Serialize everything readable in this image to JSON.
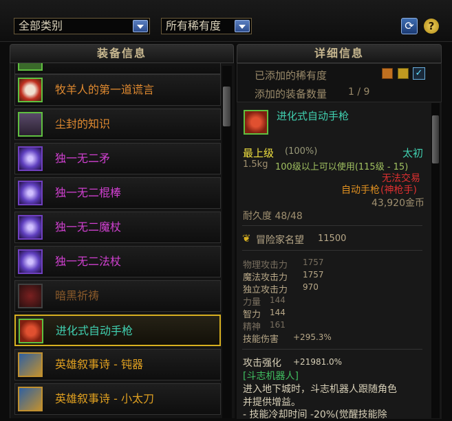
{
  "filters": {
    "category": "全部类别",
    "rarity": "所有稀有度"
  },
  "panels": {
    "left_title": "装备信息",
    "right_title": "详细信息"
  },
  "items": [
    {
      "name": "牧羊人的第一道谎言",
      "color": "#e08a30",
      "icon": "sheep-mask-icon"
    },
    {
      "name": "尘封的知识",
      "color": "#e08a30",
      "icon": "dusty-box-icon"
    },
    {
      "name": "独一无二矛",
      "color": "#d040d0",
      "icon": "spear-orb-icon"
    },
    {
      "name": "独一无二棍棒",
      "color": "#d040d0",
      "icon": "club-orb-icon"
    },
    {
      "name": "独一无二魔杖",
      "color": "#d040d0",
      "icon": "wand-orb-icon"
    },
    {
      "name": "独一无二法杖",
      "color": "#d040d0",
      "icon": "staff-orb-icon"
    },
    {
      "name": "暗黑祈祷",
      "color": "#8a5a2a",
      "icon": "dark-prayer-icon"
    },
    {
      "name": "进化式自动手枪",
      "color": "#40d0b0",
      "icon": "auto-pistol-icon"
    },
    {
      "name": "英雄叙事诗 - 钝器",
      "color": "#e0a020",
      "icon": "hero-blunt-icon"
    },
    {
      "name": "英雄叙事诗 - 小太刀",
      "color": "#e0a020",
      "icon": "hero-kodachi-icon"
    }
  ],
  "detail": {
    "added_rarity_label": "已添加的稀有度",
    "added_count_label": "添加的装备数量",
    "added_count_value": "1 / 9",
    "item_name": "进化式自动手枪",
    "grade": "最上级",
    "grade_pct": "(100%)",
    "tier": "太初",
    "weight": "1.5kg",
    "level_req": "100级以上可以使用(115级 - 15)",
    "trade": "无法交易",
    "type": "自动手枪",
    "class": "(神枪手)",
    "price": "43,920金币",
    "durability": "耐久度 48/48",
    "fame_label": "冒险家名望",
    "fame_value": "11500",
    "stats": [
      {
        "label": "物理攻击力",
        "value": "1757"
      },
      {
        "label": "魔法攻击力",
        "value": "1757"
      },
      {
        "label": "独立攻击力",
        "value": "970"
      },
      {
        "label": "力量",
        "value": "144"
      },
      {
        "label": "智力",
        "value": "144"
      },
      {
        "label": "精神",
        "value": "161"
      },
      {
        "label": "技能伤害",
        "value": "+295.3%"
      }
    ],
    "atk_boost_label": "攻击强化",
    "atk_boost_value": "+21981.0%",
    "robot_name": "[斗志机器人]",
    "desc1": "进入地下城时，斗志机器人跟随角色",
    "desc2": "并提供增益。",
    "desc3": "- 技能冷却时间 -20%(觉醒技能除"
  },
  "colors": {
    "gold": "#d8b020",
    "grade_yellow": "#f0e040",
    "teal": "#40d0b0",
    "red": "#e03030",
    "orange": "#e09020",
    "green": "#60c040"
  }
}
